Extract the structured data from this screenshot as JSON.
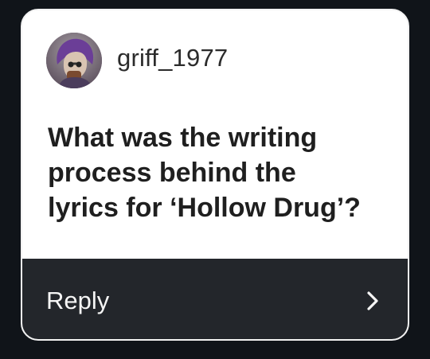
{
  "post": {
    "username": "griff_1977",
    "question": "What was the writing\nprocess behind the\nlyrics for ‘Hollow Drug’?",
    "avatar_icon": "user-avatar-illustration"
  },
  "reply": {
    "label": "Reply",
    "icon": "chevron-right-icon"
  },
  "colors": {
    "background": "#101419",
    "card": "#ffffff",
    "reply_bar": "#23262b",
    "text_dark": "#1f1f1f",
    "text_light": "#f5f5f5"
  }
}
